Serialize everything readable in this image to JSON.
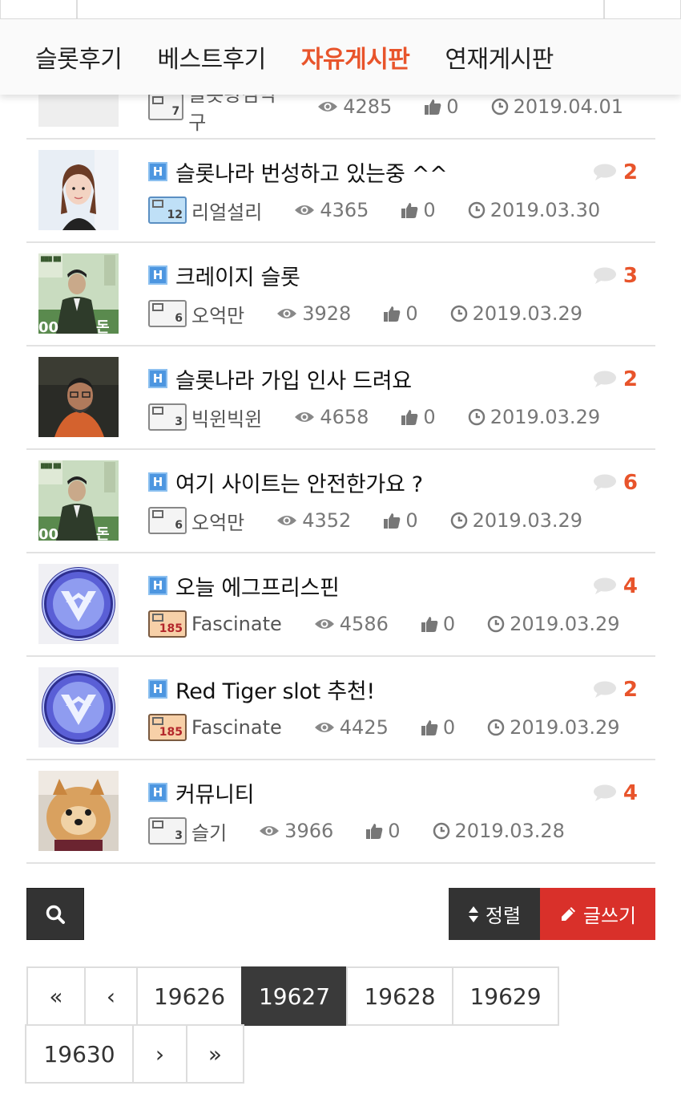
{
  "nav": {
    "items": [
      {
        "label": "슬롯후기",
        "active": false
      },
      {
        "label": "베스트후기",
        "active": false
      },
      {
        "label": "자유게시판",
        "active": true
      },
      {
        "label": "연재게시판",
        "active": false
      }
    ]
  },
  "posts": [
    {
      "title": "",
      "author": "슬롯왕김탁구",
      "level": "7",
      "views": "4285",
      "likes": "0",
      "date": "2019.04.01",
      "comments": "",
      "level_style": "gray",
      "thumb": "dark-box"
    },
    {
      "title": "슬롯나라 번성하고 있는중 ^^",
      "author": "리얼설리",
      "level": "12",
      "views": "4365",
      "likes": "0",
      "date": "2019.03.30",
      "comments": "2",
      "level_style": "blue",
      "thumb": "portrait-woman"
    },
    {
      "title": "크레이지 슬롯",
      "author": "오억만",
      "level": "6",
      "views": "3928",
      "likes": "0",
      "date": "2019.03.29",
      "comments": "3",
      "level_style": "gray",
      "thumb": "green-poster"
    },
    {
      "title": "슬롯나라 가입 인사 드려요",
      "author": "빅윈빅윈",
      "level": "3",
      "views": "4658",
      "likes": "0",
      "date": "2019.03.29",
      "comments": "2",
      "level_style": "gray",
      "thumb": "man-orange"
    },
    {
      "title": "여기 사이트는 안전한가요 ?",
      "author": "오억만",
      "level": "6",
      "views": "4352",
      "likes": "0",
      "date": "2019.03.29",
      "comments": "6",
      "level_style": "gray",
      "thumb": "green-poster"
    },
    {
      "title": "오늘 에그프리스핀",
      "author": "Fascinate",
      "level": "185",
      "views": "4586",
      "likes": "0",
      "date": "2019.03.29",
      "comments": "4",
      "level_style": "orange",
      "thumb": "blue-emblem"
    },
    {
      "title": "Red Tiger slot 추천!",
      "author": "Fascinate",
      "level": "185",
      "views": "4425",
      "likes": "0",
      "date": "2019.03.29",
      "comments": "2",
      "level_style": "orange",
      "thumb": "blue-emblem"
    },
    {
      "title": "커뮤니티",
      "author": "슬기",
      "level": "3",
      "views": "3966",
      "likes": "0",
      "date": "2019.03.28",
      "comments": "4",
      "level_style": "gray",
      "thumb": "pomeranian"
    }
  ],
  "toolbar": {
    "sort_label": "정렬",
    "write_label": "글쓰기"
  },
  "pagination": {
    "first": "«",
    "prev": "‹",
    "pages": [
      "19626",
      "19627",
      "19628",
      "19629",
      "19630"
    ],
    "current": "19627",
    "next": "›",
    "last": "»"
  },
  "colors": {
    "accent": "#e8542b",
    "write_button": "#d9302a",
    "dark_button": "#333333",
    "h_badge": "#4d96e0"
  }
}
